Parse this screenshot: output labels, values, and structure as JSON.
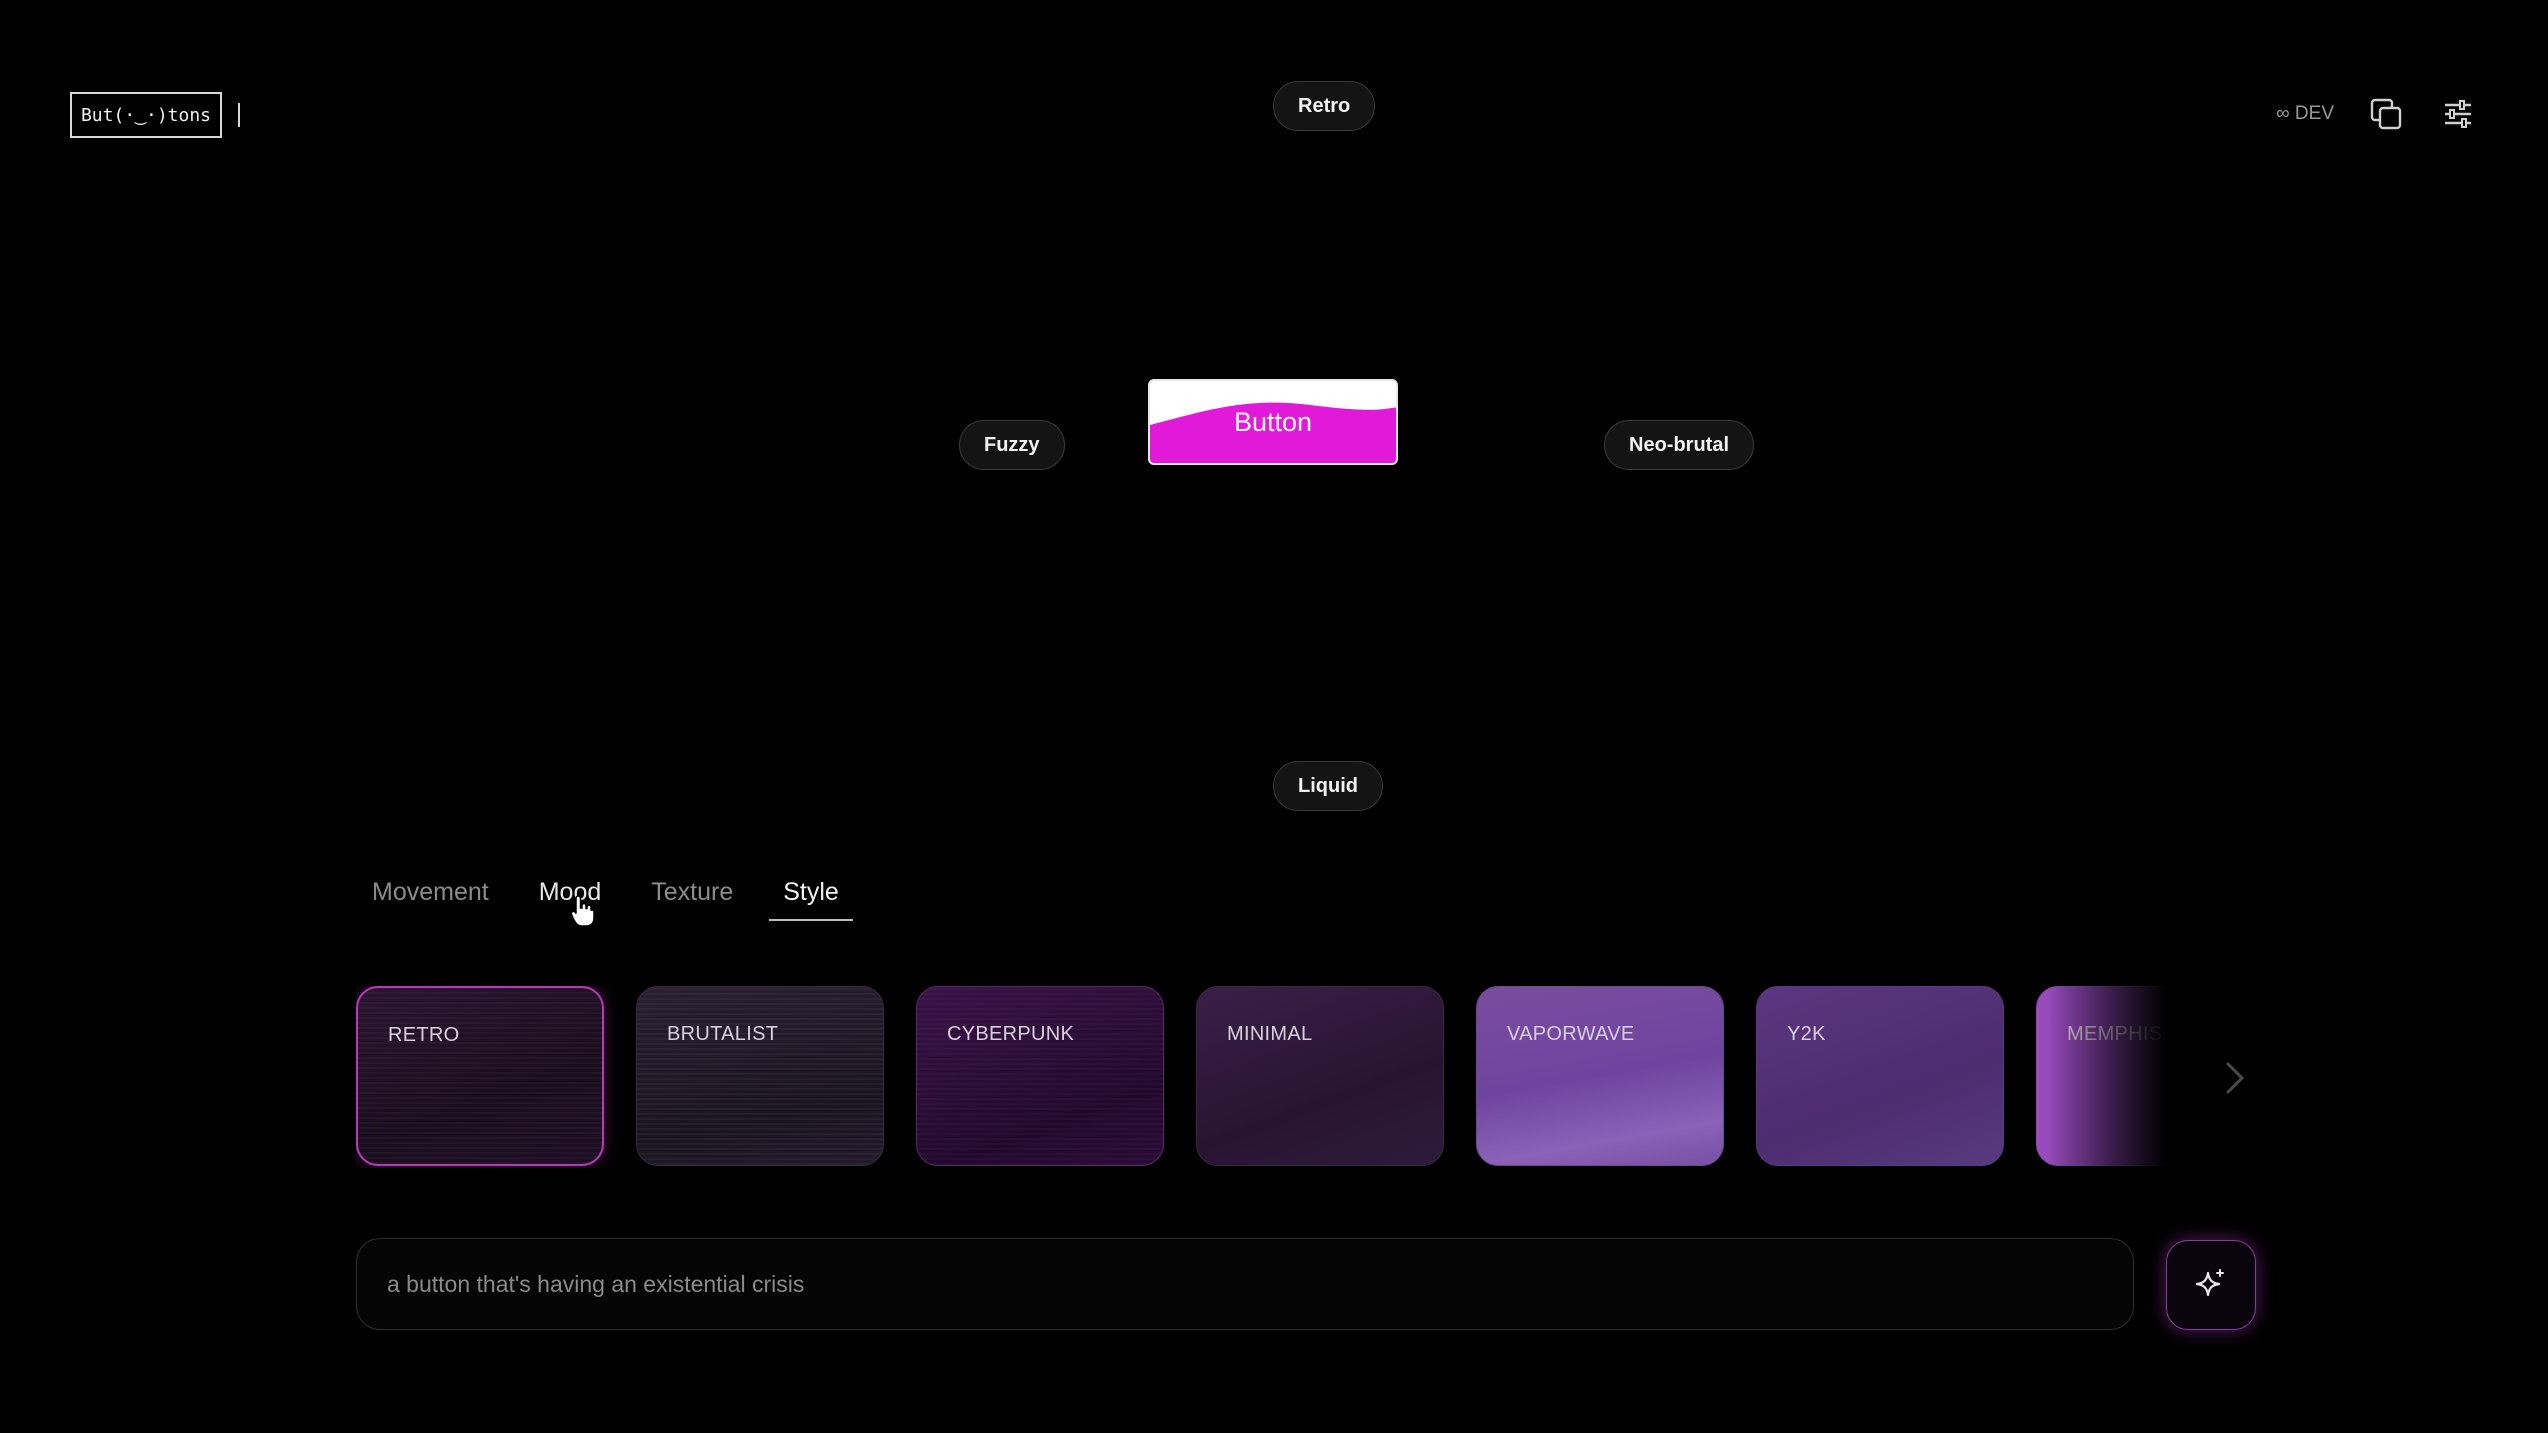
{
  "app": {
    "logo_text": "But(·‿·)tons"
  },
  "header": {
    "dev_label": "∞ DEV",
    "icons": [
      "copy-icon",
      "sliders-icon"
    ]
  },
  "stage": {
    "button_label": "Button",
    "accent_color": "#e01ad8",
    "pills": {
      "top": "Retro",
      "left": "Fuzzy",
      "right": "Neo-brutal",
      "bottom": "Liquid"
    }
  },
  "tabs": [
    {
      "label": "Movement",
      "state": "inactive"
    },
    {
      "label": "Mood",
      "state": "hover"
    },
    {
      "label": "Texture",
      "state": "inactive"
    },
    {
      "label": "Style",
      "state": "active"
    }
  ],
  "styles": [
    {
      "label": "RETRO",
      "selected": true
    },
    {
      "label": "BRUTALIST",
      "selected": false
    },
    {
      "label": "CYBERPUNK",
      "selected": false
    },
    {
      "label": "MINIMAL",
      "selected": false
    },
    {
      "label": "VAPORWAVE",
      "selected": false
    },
    {
      "label": "Y2K",
      "selected": false
    },
    {
      "label": "MEMPHIS",
      "selected": false
    }
  ],
  "prompt": {
    "placeholder": "a button that's having an existential crisis",
    "value": ""
  }
}
